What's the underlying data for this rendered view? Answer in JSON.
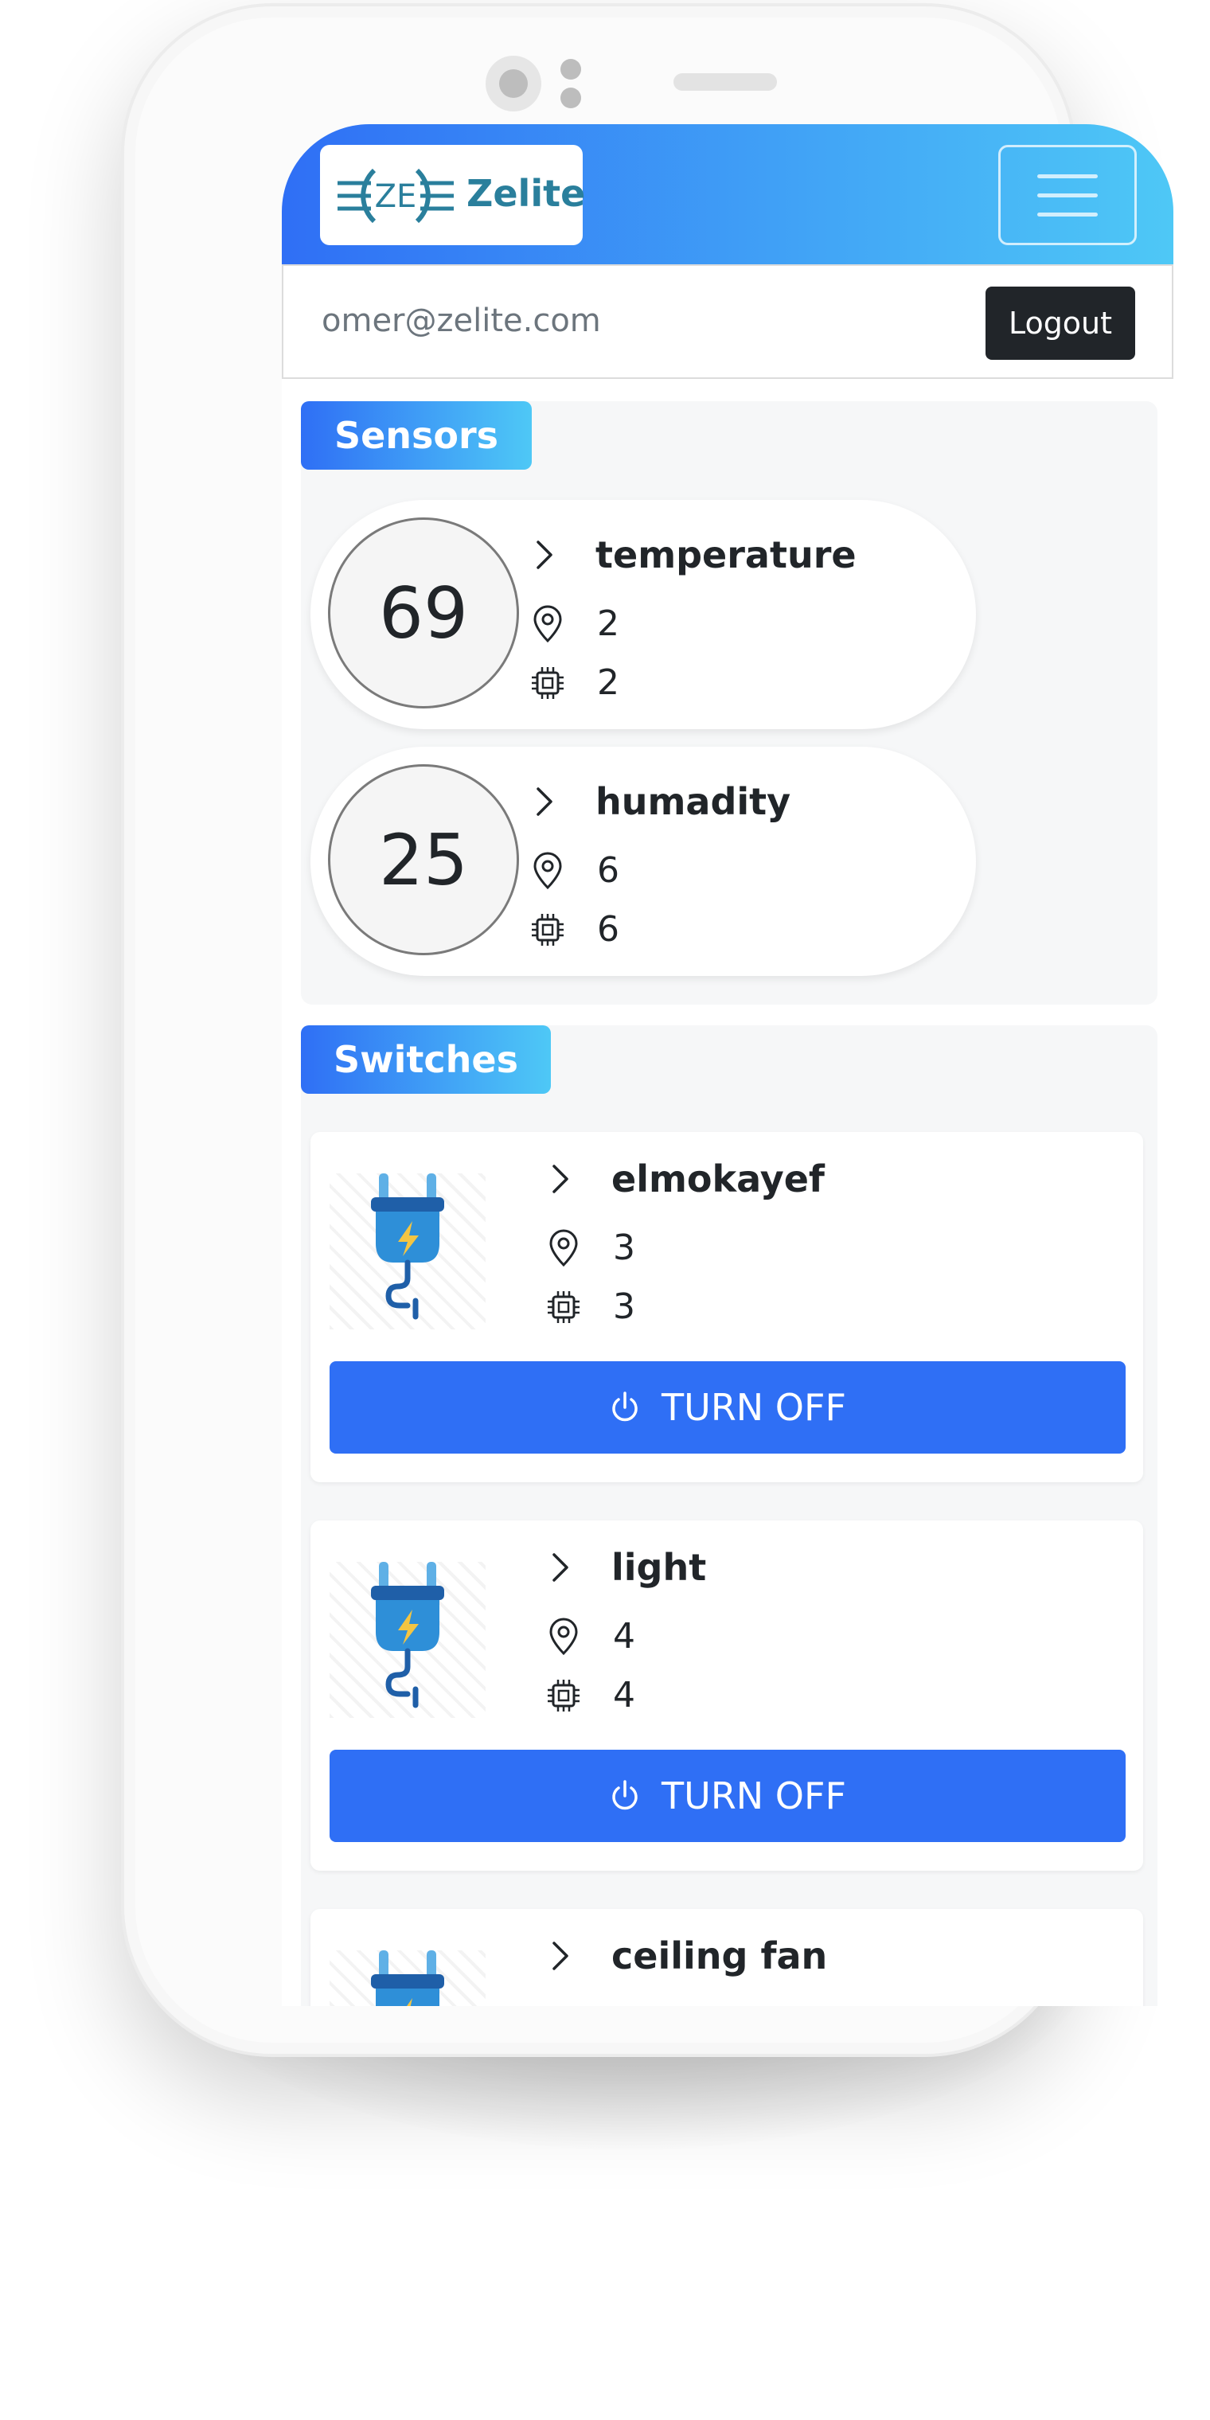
{
  "app": {
    "brand_name": "Zelite",
    "logo_text": "ZE"
  },
  "user": {
    "email": "omer@zelite.com",
    "logout_label": "Logout"
  },
  "sensors": {
    "title": "Sensors",
    "items": [
      {
        "value": "69",
        "name": "temperature",
        "location_count": "2",
        "device_count": "2"
      },
      {
        "value": "25",
        "name": "humadity",
        "location_count": "6",
        "device_count": "6"
      }
    ]
  },
  "switches": {
    "title": "Switches",
    "items": [
      {
        "name": "elmokayef",
        "location_count": "3",
        "device_count": "3",
        "button_label": "TURN OFF"
      },
      {
        "name": "light",
        "location_count": "4",
        "device_count": "4",
        "button_label": "TURN OFF"
      },
      {
        "name": "ceiling fan"
      }
    ]
  },
  "colors": {
    "primary": "#2f6ff5",
    "gradient_end": "#4ec8f6",
    "brand_teal": "#2a7f9c",
    "dark": "#212529"
  },
  "icons": {
    "expand": "chevron-right-icon",
    "location": "map-pin-icon",
    "device": "chip-icon",
    "power": "power-icon",
    "switch_image": "plug-icon",
    "menu": "hamburger-icon"
  }
}
